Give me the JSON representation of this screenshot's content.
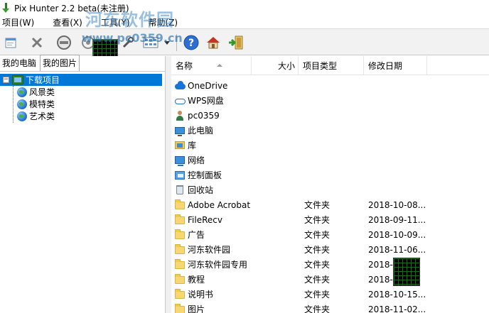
{
  "window": {
    "title": "Pix Hunter 2.2 beta(未注册)"
  },
  "menu": [
    "项目(W)",
    "查看(X)",
    "工具(Y)",
    "帮助(Z)"
  ],
  "watermark": {
    "line1": "河东软件园",
    "line2": "www.pc0359.cn"
  },
  "toolbar": {
    "icons": [
      "new-project-icon",
      "delete-icon",
      "stop-icon",
      "target-icon",
      "settings-icon",
      "thumbnails-view-icon",
      "view-dropdown-icon",
      "help-icon",
      "home-icon",
      "exit-icon"
    ]
  },
  "left_tabs": [
    "我的电脑",
    "我的图片"
  ],
  "tree": {
    "root": "下载项目",
    "children": [
      "风景类",
      "模特类",
      "艺术类"
    ]
  },
  "columns": {
    "name": "名称",
    "size": "大小",
    "type": "项目类型",
    "date": "修改日期"
  },
  "files": [
    {
      "icon": "onedrive-icon",
      "name": "OneDrive",
      "type": "",
      "date": ""
    },
    {
      "icon": "wps-cloud-icon",
      "name": "WPS网盘",
      "type": "",
      "date": ""
    },
    {
      "icon": "user-icon",
      "name": "pc0359",
      "type": "",
      "date": ""
    },
    {
      "icon": "this-pc-icon",
      "name": "此电脑",
      "type": "",
      "date": ""
    },
    {
      "icon": "library-icon",
      "name": "库",
      "type": "",
      "date": ""
    },
    {
      "icon": "network-icon",
      "name": "网络",
      "type": "",
      "date": ""
    },
    {
      "icon": "control-panel-icon",
      "name": "控制面板",
      "type": "",
      "date": ""
    },
    {
      "icon": "recycle-bin-icon",
      "name": "回收站",
      "type": "",
      "date": ""
    },
    {
      "icon": "folder-icon",
      "name": "Adobe Acrobat",
      "type": "文件夹",
      "date": "2018-10-08..."
    },
    {
      "icon": "folder-icon",
      "name": "FileRecv",
      "type": "文件夹",
      "date": "2018-09-11..."
    },
    {
      "icon": "folder-icon",
      "name": "广告",
      "type": "文件夹",
      "date": "2018-10-09..."
    },
    {
      "icon": "folder-icon",
      "name": "河东软件园",
      "type": "文件夹",
      "date": "2018-11-06..."
    },
    {
      "icon": "folder-icon",
      "name": "河东软件园专用",
      "type": "文件夹",
      "date": "2018-1"
    },
    {
      "icon": "folder-icon",
      "name": "教程",
      "type": "文件夹",
      "date": "2018-1"
    },
    {
      "icon": "folder-icon",
      "name": "说明书",
      "type": "文件夹",
      "date": "2018-10-15..."
    },
    {
      "icon": "folder-icon",
      "name": "图片",
      "type": "文件夹",
      "date": "2018-11-02..."
    }
  ]
}
